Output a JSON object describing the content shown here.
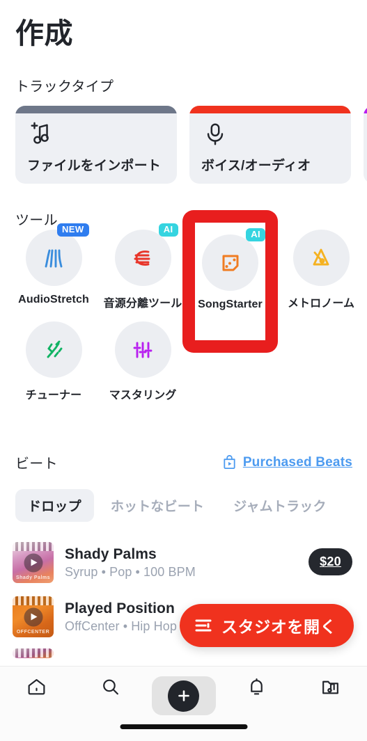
{
  "header": {
    "title": "作成"
  },
  "track_type": {
    "section_label": "トラックタイプ",
    "cards": [
      {
        "label": "ファイルをインポート",
        "icon": "music-note-plus-icon",
        "bar_color": "#6e7789"
      },
      {
        "label": "ボイス/オーディオ",
        "icon": "microphone-icon",
        "bar_color": "#f0321e"
      },
      {
        "label": "",
        "icon": "drum-pad-icon",
        "bar_color": "#b81ff0"
      }
    ]
  },
  "tools": {
    "section_label": "ツール",
    "items": [
      {
        "label": "AudioStretch",
        "icon": "audio-stretch-icon",
        "badge": "NEW",
        "badge_type": "new",
        "color": "#3a8ddd"
      },
      {
        "label": "音源分離ツール",
        "icon": "stem-splitter-icon",
        "badge": "AI",
        "badge_type": "ai",
        "color": "#e8352a"
      },
      {
        "label": "SongStarter",
        "icon": "song-starter-icon",
        "badge": "AI",
        "badge_type": "ai",
        "color": "#f07c22"
      },
      {
        "label": "メトロノーム",
        "icon": "metronome-icon",
        "badge": "",
        "badge_type": "",
        "color": "#f5b221"
      },
      {
        "label": "チューナー",
        "icon": "tuning-fork-icon",
        "badge": "",
        "badge_type": "",
        "color": "#11b364"
      },
      {
        "label": "マスタリング",
        "icon": "mastering-sliders-icon",
        "badge": "",
        "badge_type": "",
        "color": "#b81ff0"
      }
    ]
  },
  "beats": {
    "section_label": "ビート",
    "purchased_link": "Purchased Beats",
    "purchased_icon": "shopping-bag-play-icon",
    "tabs": [
      {
        "label": "ドロップ",
        "active": true
      },
      {
        "label": "ホットなビート",
        "active": false
      },
      {
        "label": "ジャムトラック",
        "active": false
      }
    ],
    "list": [
      {
        "title": "Shady Palms",
        "subtitle": "Syrup • Pop • 100 BPM",
        "price": "$20",
        "thumb_text": "Shady Palms"
      },
      {
        "title": "Played Position",
        "subtitle": "OffCenter • Hip Hop",
        "price": "",
        "thumb_text": "OFFCENTER"
      }
    ]
  },
  "studio_button": {
    "label": "スタジオを開く",
    "icon": "tracks-mixer-icon",
    "color": "#f0321e"
  },
  "bottom_nav": {
    "items": [
      {
        "name": "home",
        "icon": "home-icon",
        "active": false
      },
      {
        "name": "search",
        "icon": "search-icon",
        "active": false
      },
      {
        "name": "create",
        "icon": "plus-icon",
        "active": true
      },
      {
        "name": "notifications",
        "icon": "bell-icon",
        "active": false
      },
      {
        "name": "library",
        "icon": "folder-music-icon",
        "active": false
      }
    ]
  },
  "annotation": {
    "target": "SongStarter",
    "color": "#e81e1e"
  }
}
